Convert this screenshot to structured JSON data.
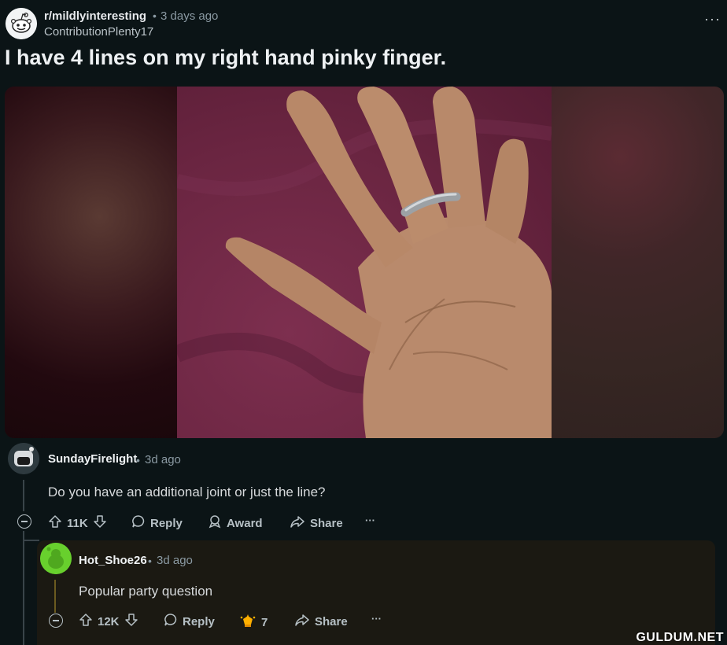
{
  "post": {
    "subreddit": "r/mildlyinteresting",
    "separator": "•",
    "time_ago": "3 days ago",
    "author": "ContributionPlenty17",
    "title": "I have 4 lines on my right hand pinky finger.",
    "more_label": "···"
  },
  "comments": [
    {
      "username": "SundayFirelight",
      "separator": "•",
      "time_ago": "3d ago",
      "body": "Do you have an additional joint or just the line?",
      "votes": "11K",
      "reply_label": "Reply",
      "award_label": "Award",
      "share_label": "Share",
      "more_label": "···"
    },
    {
      "username": "Hot_Shoe26",
      "separator": "•",
      "time_ago": "3d ago",
      "body": "Popular party question",
      "votes": "12K",
      "reply_label": "Reply",
      "award_count": "7",
      "share_label": "Share",
      "more_label": "···"
    }
  ],
  "watermark": "GULDUM.NET",
  "colors": {
    "background": "#0b1416",
    "reply_panel": "#1b1912",
    "reply_avatar": "#68d02d"
  }
}
